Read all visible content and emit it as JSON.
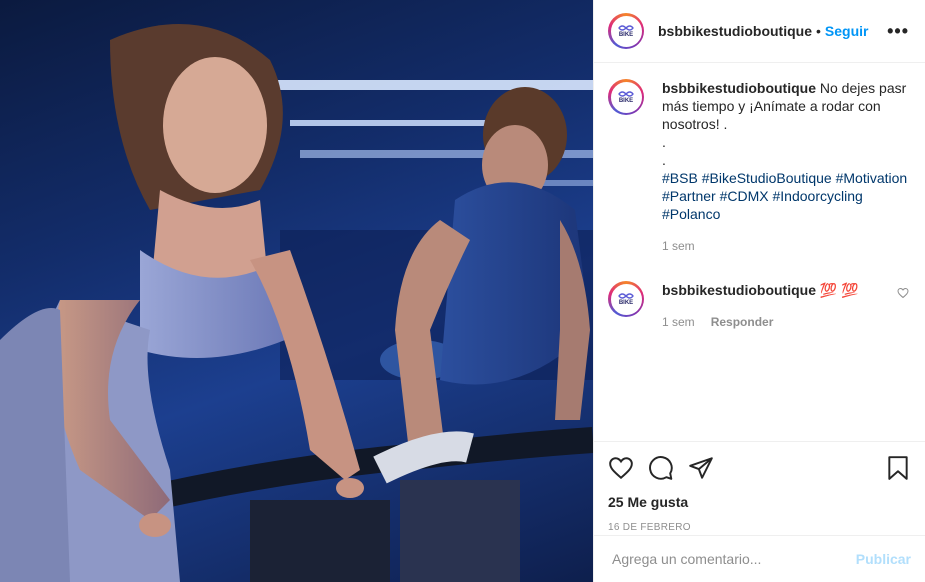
{
  "post": {
    "username": "bsbbikestudioboutique",
    "follow_label": "Seguir",
    "separator": "•",
    "more_label": "•••",
    "avatar_text": "BIKE",
    "caption_lines": "No dejes pasr más tiempo y ¡Anímate a rodar con nosotros! .\n.\n.",
    "hashtags": [
      "#BSB",
      "#BikeStudioBoutique",
      "#Motivation",
      "#Partner",
      "#CDMX",
      "#Indoorcycling",
      "#Polanco"
    ],
    "caption_time": "1 sem",
    "comment": {
      "username": "bsbbikestudioboutique",
      "text": "💯 💯",
      "time": "1 sem",
      "reply_label": "Responder"
    },
    "likes": "25 Me gusta",
    "date": "16 DE FEBRERO",
    "comment_placeholder": "Agrega un comentario...",
    "publish_label": "Publicar"
  },
  "colors": {
    "follow": "#0095f6",
    "hashtag": "#00376b",
    "publish_disabled": "#b2dffc"
  }
}
